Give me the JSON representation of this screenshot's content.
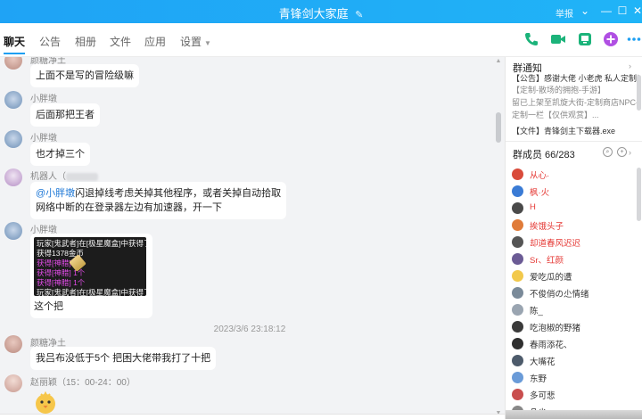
{
  "window": {
    "title": "青锋剑大家庭",
    "edit_icon": "pencil-icon",
    "report": "举报",
    "controls": [
      "chevron-down-icon",
      "minimize-icon",
      "maximize-icon",
      "close-icon"
    ]
  },
  "tabs": [
    {
      "label": "聊天",
      "active": true
    },
    {
      "label": "公告"
    },
    {
      "label": "相册"
    },
    {
      "label": "文件"
    },
    {
      "label": "应用"
    },
    {
      "label": "设置"
    }
  ],
  "toolbar_icons": {
    "phone": "#1bb37a",
    "video": "#1bb37a",
    "screen": "#1bb37a",
    "add": "#b04fe3",
    "more": "#1e9ff2"
  },
  "messages": [
    {
      "nick": "颜糖净土",
      "text": "上面不是写的冒险级嘛"
    },
    {
      "nick": "小胖墩",
      "text": "后面那把王者"
    },
    {
      "nick": "小胖墩",
      "text": "也才掉三个"
    },
    {
      "nick": "机器人（",
      "mention": "@小胖墩",
      "line1": "闪退掉线考虑关掉其他程序，或者关掉自动拾取",
      "line2": "网络中断的在登录器左边有加速器，开一下"
    },
    {
      "nick": "小胖墩",
      "caption": "这个把",
      "game_lines": [
        "玩家[鬼武者]在[极星魔盒]中获得了",
        "获得1378金币",
        "获得[神腊]   个",
        "获得[神腊]   1个",
        "获得[神腊]   1个",
        "玩家[鬼武者]在[极星魔盒]中获得了"
      ]
    },
    {
      "timestamp": "2023/3/6 23:18:12"
    },
    {
      "nick": "颜糖净土",
      "text": "我吕布没低于5个 把困大佬带我打了十把"
    },
    {
      "nick": "赵丽颖（15：00-24：00）",
      "sticker": "chick-sticker"
    }
  ],
  "panel": {
    "notice_title": "群通知",
    "notice_lines": [
      "【公告】感谢大佬 小老虎 私人定制武器",
      "【定制-散场的拥抱-手游】",
      "留已上架至凯旋大街-定制商店NPC-私人",
      "定制一栏【仅供观赏】...",
      "【文件】青锋剑主下载器.exe"
    ],
    "members_title": "群成员 66/283",
    "members": [
      {
        "name": "从心·",
        "red": true,
        "color": "#d94b3b"
      },
      {
        "name": "枫·火",
        "red": true,
        "color": "#3a7bd5"
      },
      {
        "name": "H",
        "red": true,
        "color": "#4a4a4a"
      },
      {
        "name": "挨饿头子",
        "red": true,
        "color": "#e07b39"
      },
      {
        "name": "却道春风迟迟",
        "red": true,
        "color": "#555"
      },
      {
        "name": "Sr、红颜",
        "red": true,
        "color": "#6b5b95"
      },
      {
        "name": "爱吃瓜的遭",
        "red": false,
        "color": "#f2c94c"
      },
      {
        "name": "不俊俏の尐情绪",
        "red": false,
        "color": "#7a8a99"
      },
      {
        "name": "陈_",
        "red": false,
        "color": "#9aa5b1"
      },
      {
        "name": "吃泡椒的野猪",
        "red": false,
        "color": "#3b3b3b"
      },
      {
        "name": "春雨添花、",
        "red": false,
        "color": "#2f2f2f"
      },
      {
        "name": "大嘴花",
        "red": false,
        "color": "#4d5b6b"
      },
      {
        "name": "东野",
        "red": false,
        "color": "#6a9bd8"
      },
      {
        "name": "多可悲",
        "red": false,
        "color": "#c94e4e"
      },
      {
        "name": "凡尘",
        "red": false,
        "color": "#888"
      }
    ]
  }
}
